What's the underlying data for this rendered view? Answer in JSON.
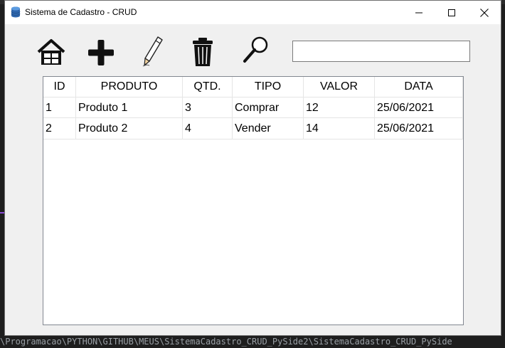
{
  "window": {
    "title": "Sistema de Cadastro - CRUD",
    "controls": {
      "minimize": "minimize",
      "maximize": "maximize",
      "close": "close"
    }
  },
  "toolbar": {
    "icons": [
      "home-icon",
      "add-icon",
      "edit-pencil-icon",
      "trash-icon",
      "search-icon"
    ],
    "search": {
      "value": "",
      "placeholder": ""
    }
  },
  "table": {
    "columns": [
      "ID",
      "PRODUTO",
      "QTD.",
      "TIPO",
      "VALOR",
      "DATA"
    ],
    "rows": [
      [
        "1",
        "Produto 1",
        "3",
        "Comprar",
        "12",
        "25/06/2021"
      ],
      [
        "2",
        "Produto 2",
        "4",
        "Vender",
        "14",
        "25/06/2021"
      ]
    ]
  },
  "background": {
    "terminal_path": "\\Programacao\\PYTHON\\GITHUB\\MEUS\\SistemaCadastro_CRUD_PySide2\\SistemaCadastro_CRUD_PySide"
  },
  "colors": {
    "window_bg": "#f0f0f0",
    "titlebar_bg": "#ffffff",
    "table_border": "#828790",
    "grid_line": "#e5e5e5",
    "desktop_bg": "#1e1e1e"
  }
}
